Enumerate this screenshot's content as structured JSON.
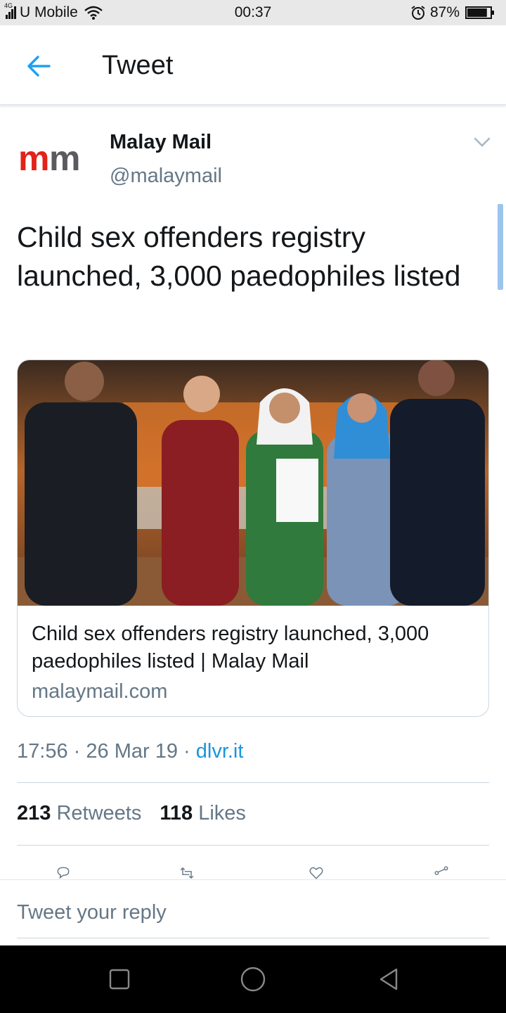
{
  "status_bar": {
    "network": "4G",
    "carrier": "U Mobile",
    "time": "00:37",
    "battery": "87%",
    "battery_level": 0.87,
    "icons": [
      "signal-icon",
      "wifi-icon",
      "alarm-icon",
      "battery-icon"
    ]
  },
  "header": {
    "title": "Tweet",
    "back_icon": "arrow-left-icon"
  },
  "tweet": {
    "author": {
      "name": "Malay Mail",
      "handle": "@malaymail",
      "logo_text": "mm"
    },
    "text": "Child sex offenders registry launched, 3,000 paedophiles listed",
    "card": {
      "title": "Child sex offenders registry launched, 3,000 paedophiles listed | Malay Mail",
      "domain": "malaymail.com"
    },
    "time": "17:56",
    "date": "26 Mar 19",
    "source": "dlvr.it",
    "separator": "·",
    "stats": {
      "retweets_count": "213",
      "retweets_label": "Retweets",
      "likes_count": "118",
      "likes_label": "Likes"
    },
    "actions": [
      "reply-icon",
      "retweet-icon",
      "like-icon",
      "share-icon"
    ]
  },
  "reply": {
    "placeholder": "Tweet your reply"
  },
  "colors": {
    "accent": "#1b95e0",
    "text_primary": "#14171a",
    "text_secondary": "#657786",
    "border": "#ccd6dd",
    "logo_red": "#e2231a"
  }
}
